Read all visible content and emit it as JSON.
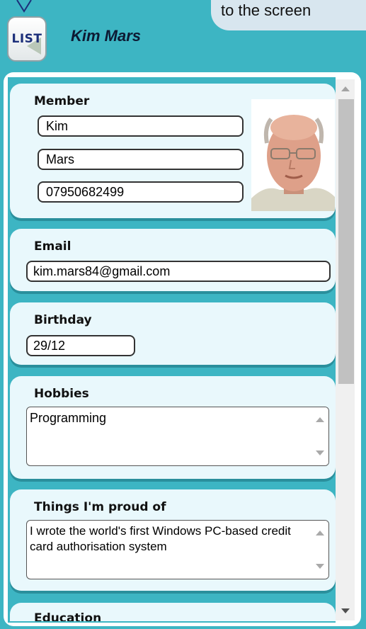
{
  "header": {
    "list_button_label": "LIST",
    "title": "Kim Mars",
    "tooltip_text": "to the screen"
  },
  "member": {
    "label": "Member",
    "first_name": "Kim",
    "last_name": "Mars",
    "phone": "07950682499"
  },
  "email": {
    "label": "Email",
    "value": "kim.mars84@gmail.com"
  },
  "birthday": {
    "label": "Birthday",
    "value": "29/12"
  },
  "hobbies": {
    "label": "Hobbies",
    "value": "Programming"
  },
  "proud_of": {
    "label": "Things I'm proud of",
    "value": "I wrote the world's first Windows PC-based credit card authorisation system"
  },
  "education": {
    "label": "Education"
  },
  "colors": {
    "background_teal": "#3db5c3",
    "section_fill": "#e9f8fc",
    "tooltip_fill": "#d8e6ef",
    "title_color": "#0d1a33"
  },
  "icons": [
    "list-icon",
    "scroll-up-icon",
    "scroll-down-icon"
  ]
}
